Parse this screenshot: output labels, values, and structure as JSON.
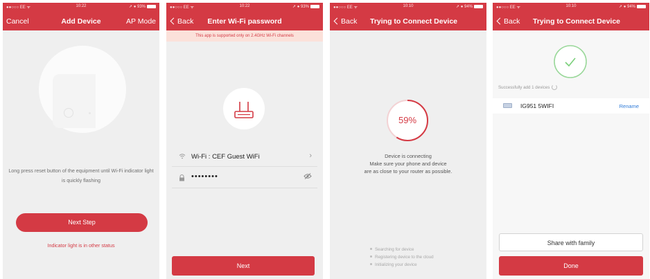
{
  "status": {
    "carrier": "●●○○○ EE ᯤ",
    "battery": "➚ ● 93%",
    "battery_alt": "➚ ● 94%",
    "time_a": "10:22",
    "time_b": "10:10"
  },
  "panel1": {
    "nav_left": "Cancel",
    "title": "Add Device",
    "nav_right": "AP Mode",
    "instruction": "Long press reset button of the equipment  until Wi-Fi indicator light is quickly flashing",
    "next_label": "Next Step",
    "other_status_link": "Indicator light is in other status"
  },
  "panel2": {
    "nav_left": "Back",
    "title": "Enter Wi-Fi password",
    "banner": "This app is supported only on 2.4GHz Wi-Fi channels",
    "wifi_label": "Wi-Fi : CEF Guest WiFi",
    "password_value": "••••••••",
    "next_label": "Next"
  },
  "panel3": {
    "nav_left": "Back",
    "title": "Trying to Connect Device",
    "progress_text": "59%",
    "progress_fraction": 0.59,
    "line1": "Device is connecting",
    "line2": "Make sure your phone and device",
    "line3": "are as close to your router as possible.",
    "steps": [
      "Searching for device",
      "Registering device to the cloud",
      "Initializing your device"
    ]
  },
  "panel4": {
    "nav_left": "Back",
    "title": "Trying to Connect Device",
    "success_text": "Successfully add 1 devices",
    "device_name": "IG951 5WIFI",
    "rename_label": "Rename",
    "share_label": "Share with family",
    "done_label": "Done"
  },
  "colors": {
    "accent": "#d43a44",
    "success": "#7bd07b",
    "link": "#2f7bd8"
  },
  "icons": [
    "router-icon",
    "wifi-icon",
    "lock-icon",
    "eye-off-icon",
    "chevron-right-icon",
    "check-icon",
    "spinner-icon",
    "device-icon"
  ]
}
